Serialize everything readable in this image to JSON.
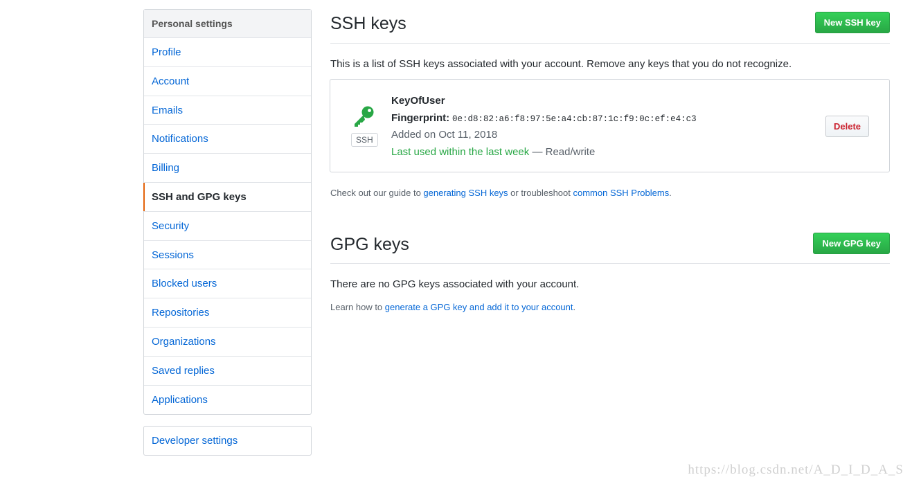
{
  "sidebar": {
    "heading": "Personal settings",
    "items": [
      {
        "label": "Profile"
      },
      {
        "label": "Account"
      },
      {
        "label": "Emails"
      },
      {
        "label": "Notifications"
      },
      {
        "label": "Billing"
      },
      {
        "label": "SSH and GPG keys",
        "selected": true
      },
      {
        "label": "Security"
      },
      {
        "label": "Sessions"
      },
      {
        "label": "Blocked users"
      },
      {
        "label": "Repositories"
      },
      {
        "label": "Organizations"
      },
      {
        "label": "Saved replies"
      },
      {
        "label": "Applications"
      }
    ],
    "developer_settings": "Developer settings"
  },
  "ssh": {
    "title": "SSH keys",
    "new_button": "New SSH key",
    "intro": "This is a list of SSH keys associated with your account. Remove any keys that you do not recognize.",
    "key": {
      "icon": "key-icon",
      "badge": "SSH",
      "name": "KeyOfUser",
      "fingerprint_label": "Fingerprint:",
      "fingerprint": "0e:d8:82:a6:f8:97:5e:a4:cb:87:1c:f9:0c:ef:e4:c3",
      "added": "Added on Oct 11, 2018",
      "last_used": "Last used within the last week",
      "access": "— Read/write",
      "delete_button": "Delete"
    },
    "guide": {
      "prefix": "Check out our guide to ",
      "link1": "generating SSH keys",
      "middle": " or troubleshoot ",
      "link2": "common SSH Problems",
      "suffix": "."
    }
  },
  "gpg": {
    "title": "GPG keys",
    "new_button": "New GPG key",
    "empty": "There are no GPG keys associated with your account.",
    "learn": {
      "prefix": "Learn how to ",
      "link": "generate a GPG key and add it to your account",
      "suffix": "."
    }
  },
  "watermark": "https://blog.csdn.net/A_D_I_D_A_S",
  "colors": {
    "link": "#0366d6",
    "primary_button": "#28a745",
    "selected_marker": "#e36209",
    "delete": "#cb2431",
    "key_icon": "#28a745"
  }
}
